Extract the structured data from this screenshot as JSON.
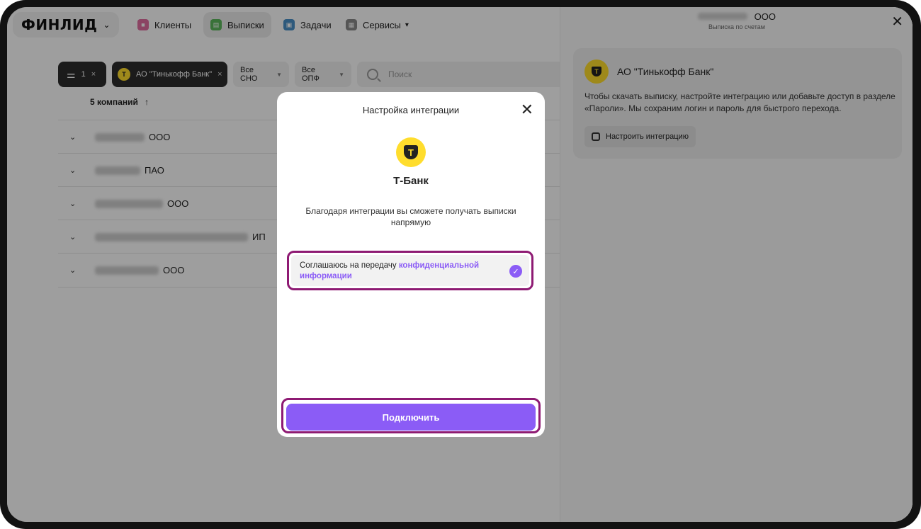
{
  "nav": {
    "logo": "ФИНЛИД",
    "items": [
      {
        "label": "Клиенты",
        "icon": "briefcase-icon",
        "color": "#e06fa0"
      },
      {
        "label": "Выписки",
        "icon": "document-icon",
        "color": "#5cb85c"
      },
      {
        "label": "Задачи",
        "icon": "tasks-icon",
        "color": "#4a90c8"
      },
      {
        "label": "Сервисы",
        "icon": "grid-icon",
        "color": "#8a8a8a"
      }
    ]
  },
  "filters": {
    "count_chip": "1",
    "bank_chip": "АО \"Тинькофф Банк\"",
    "sno": "Все СНО",
    "opf": "Все ОПФ",
    "search_placeholder": "Поиск"
  },
  "list": {
    "count_label": "5 компаний",
    "sort_icon": "↑",
    "rows": [
      {
        "suffix": "ООО"
      },
      {
        "suffix": "ПАО"
      },
      {
        "suffix": "ООО"
      },
      {
        "suffix": "ИП"
      },
      {
        "suffix": "ООО"
      }
    ]
  },
  "panel": {
    "title_suffix": "ООО",
    "subtitle": "Выписка по счетам",
    "bank_name": "АО \"Тинькофф Банк\"",
    "description": "Чтобы скачать выписку, настройте интеграцию или добавьте доступ в разделе «Пароли». Мы сохраним логин и пароль для быстрого перехода.",
    "setup_button": "Настроить интеграцию"
  },
  "modal": {
    "title": "Настройка интеграции",
    "bank": "Т-Банк",
    "description": "Благодаря интеграции вы сможете получать выписки напрямую",
    "consent_text": "Соглашаюсь на передачу ",
    "consent_link": "конфиденциальной информации",
    "consent_checked": true,
    "connect_button": "Подключить"
  },
  "colors": {
    "accent": "#8b5cf6",
    "highlight": "#8e1a73",
    "bank_yellow": "#ffdd2d"
  }
}
